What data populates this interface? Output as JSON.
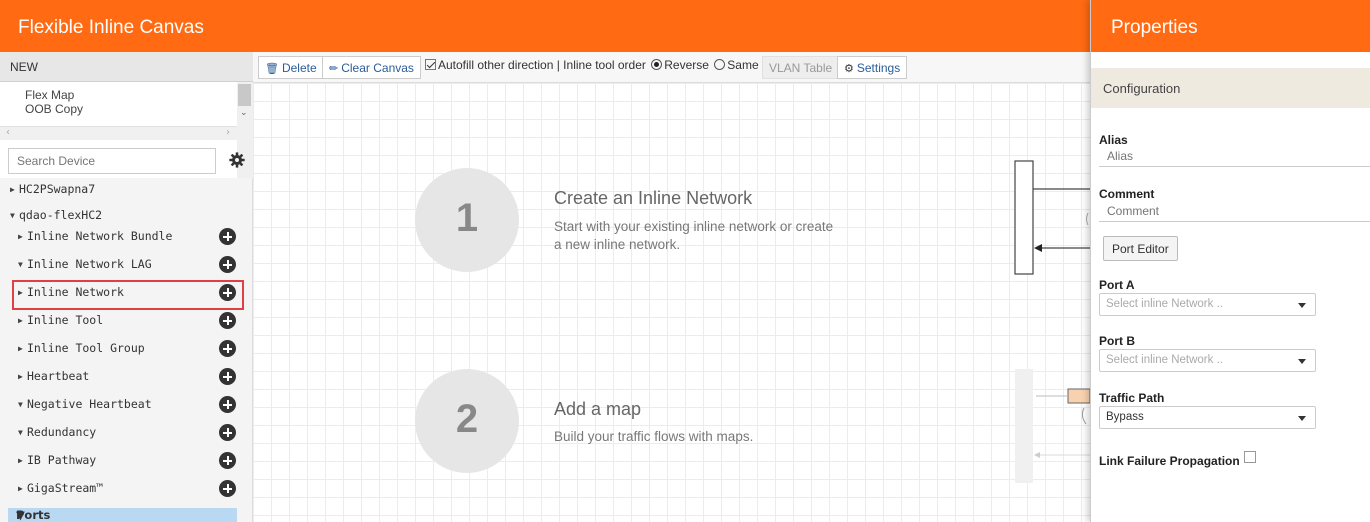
{
  "app": {
    "title": "Flexible Inline Canvas"
  },
  "left_panel": {
    "new_label": "NEW",
    "maps": [
      "Flex Map",
      "OOB Copy"
    ],
    "search_placeholder": "Search Device",
    "tree": [
      {
        "label": "HC2PSwapna7",
        "state": "collapsed",
        "level": 0,
        "plus": false
      },
      {
        "label": "qdao-flexHC2",
        "state": "expanded",
        "level": 0,
        "plus": false
      },
      {
        "label": "Inline Network Bundle",
        "state": "collapsed",
        "level": 1,
        "plus": true
      },
      {
        "label": "Inline Network LAG",
        "state": "expanded",
        "level": 1,
        "plus": true
      },
      {
        "label": "Inline Network",
        "state": "collapsed",
        "level": 1,
        "plus": true,
        "highlighted": true
      },
      {
        "label": "Inline Tool",
        "state": "collapsed",
        "level": 1,
        "plus": true
      },
      {
        "label": "Inline Tool Group",
        "state": "collapsed",
        "level": 1,
        "plus": true
      },
      {
        "label": "Heartbeat",
        "state": "collapsed",
        "level": 1,
        "plus": true
      },
      {
        "label": "Negative Heartbeat",
        "state": "expanded",
        "level": 1,
        "plus": true
      },
      {
        "label": "Redundancy",
        "state": "expanded",
        "level": 1,
        "plus": true
      },
      {
        "label": "IB Pathway",
        "state": "collapsed",
        "level": 1,
        "plus": true
      },
      {
        "label": "GigaStream™",
        "state": "collapsed",
        "level": 1,
        "plus": true
      }
    ],
    "ports_label": "Ports"
  },
  "toolbar": {
    "delete_label": "Delete",
    "clear_label": "Clear Canvas",
    "autofill_label": "Autofill other direction | Inline tool order",
    "reverse_label": "Reverse",
    "same_label": "Same",
    "vlan_label": "VLAN Table",
    "settings_label": "Settings"
  },
  "canvas": {
    "steps": [
      {
        "number": "1",
        "title": "Create an Inline Network",
        "desc_line1": "Start with your existing inline network or create",
        "desc_line2": "a new inline network."
      },
      {
        "number": "2",
        "title": "Add a map",
        "desc_line1": "Build your traffic flows with maps.",
        "desc_line2": ""
      }
    ]
  },
  "properties": {
    "title": "Properties",
    "section": "Configuration",
    "alias_label": "Alias",
    "alias_placeholder": "Alias",
    "comment_label": "Comment",
    "comment_placeholder": "Comment",
    "port_editor_label": "Port Editor",
    "port_a_label": "Port A",
    "port_a_placeholder": "Select inline Network ..",
    "port_b_label": "Port B",
    "port_b_placeholder": "Select inline Network ..",
    "traffic_path_label": "Traffic Path",
    "traffic_path_value": "Bypass",
    "link_failure_label": "Link Failure Propagation"
  },
  "colors": {
    "accent": "#ff6a13",
    "selection": "#b9d8f2",
    "highlight_box": "#e04040"
  },
  "icons": [
    "trash-icon",
    "eraser-icon",
    "gear-icon",
    "plus-circle-icon",
    "chevron-down-icon"
  ]
}
